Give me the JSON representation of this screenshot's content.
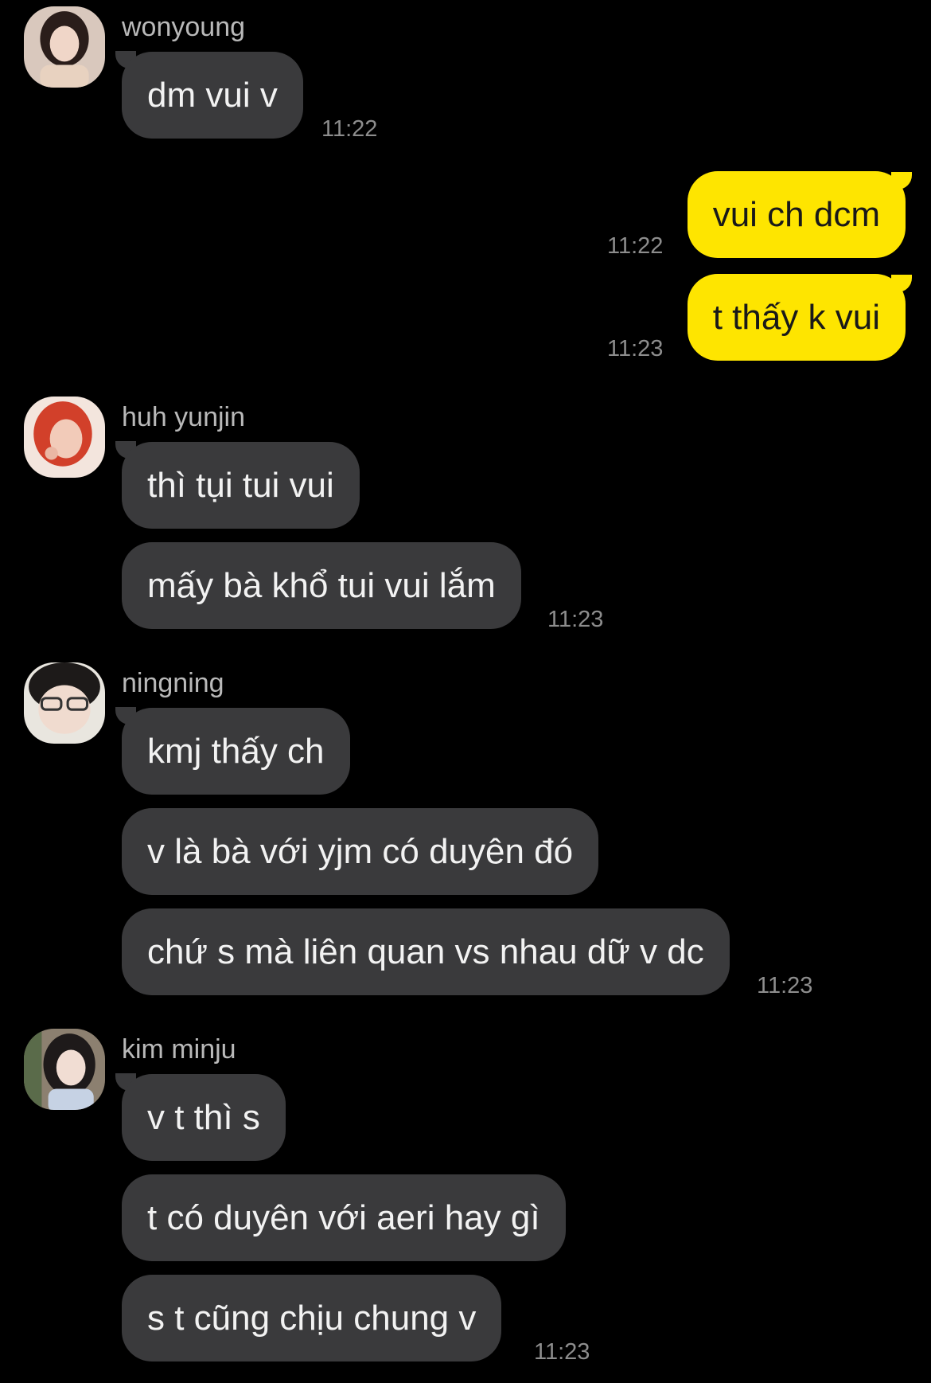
{
  "chat": {
    "groups": [
      {
        "sender": "wonyoung",
        "avatar_icon": "user-avatar-icon",
        "messages": [
          "dm vui v"
        ],
        "time": "11:22"
      },
      {
        "sender": "me",
        "messages": [
          {
            "text": "vui ch dcm",
            "time": "11:22"
          },
          {
            "text": "t thấy k vui",
            "time": "11:23"
          }
        ]
      },
      {
        "sender": "huh yunjin",
        "avatar_icon": "user-avatar-icon",
        "messages": [
          "thì tụi tui vui",
          "mấy bà khổ tui vui lắm"
        ],
        "time": "11:23"
      },
      {
        "sender": "ningning",
        "avatar_icon": "user-avatar-icon",
        "messages": [
          "kmj thấy ch",
          "v là bà với yjm có duyên đó",
          "chứ s mà liên quan vs nhau dữ v dc"
        ],
        "time": "11:23"
      },
      {
        "sender": "kim minju",
        "avatar_icon": "user-avatar-icon",
        "messages": [
          "v t thì s",
          "t có duyên với aeri hay gì",
          "s t cũng chịu chung v"
        ],
        "time": "11:23"
      }
    ]
  },
  "colors": {
    "background": "#000000",
    "incoming_bubble": "#3a3a3c",
    "outgoing_bubble": "#fee500",
    "sender_name": "#b9b9b9",
    "timestamp": "#8d8d8d"
  }
}
